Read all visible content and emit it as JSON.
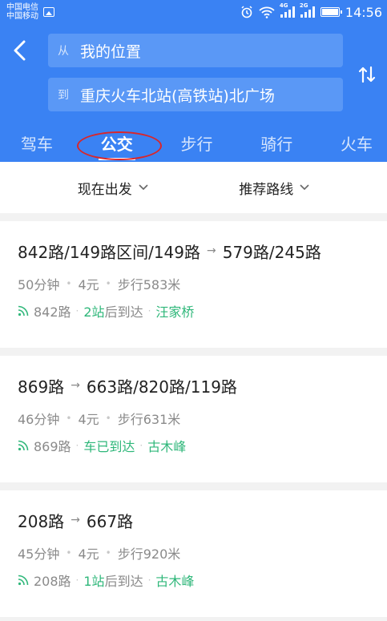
{
  "status_bar": {
    "carrier1": "中国电信",
    "carrier2": "中国移动",
    "sig1_tag": "4G",
    "sig2_tag": "2G",
    "time": "14:56"
  },
  "header": {
    "from_prefix": "从",
    "from_value": "我的位置",
    "to_prefix": "到",
    "to_value": "重庆火车北站(高铁站)北广场"
  },
  "tabs": [
    {
      "label": "驾车"
    },
    {
      "label": "公交"
    },
    {
      "label": "步行"
    },
    {
      "label": "骑行"
    },
    {
      "label": "火车"
    }
  ],
  "filters": {
    "depart": "现在出发",
    "sort": "推荐路线"
  },
  "routes": [
    {
      "seg1": "842路/149路区间/149路",
      "seg2": "579路/245路",
      "duration": "50分钟",
      "price": "4元",
      "walk": "步行583米",
      "line": "842路",
      "status_num": "2站",
      "status_text": "后到达",
      "station": "汪家桥"
    },
    {
      "seg1": "869路",
      "seg2": "663路/820路/119路",
      "duration": "46分钟",
      "price": "4元",
      "walk": "步行631米",
      "line": "869路",
      "status_num": "车已到达",
      "status_text": "",
      "station": "古木峰"
    },
    {
      "seg1": "208路",
      "seg2": "667路",
      "duration": "45分钟",
      "price": "4元",
      "walk": "步行920米",
      "line": "208路",
      "status_num": "1站",
      "status_text": "后到达",
      "station": "古木峰"
    }
  ],
  "colors": {
    "brand_blue": "#3a82f3",
    "live_green": "#2fb77a",
    "annotation_red": "#d9262a"
  }
}
